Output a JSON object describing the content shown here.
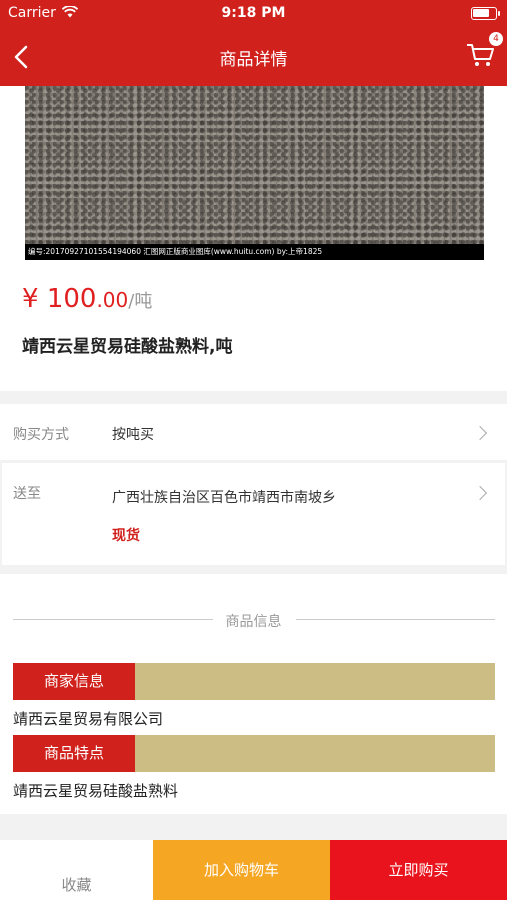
{
  "status_bar": {
    "carrier": "Carrier",
    "time": "9:18 PM"
  },
  "nav": {
    "title": "商品详情",
    "cart_badge": "4"
  },
  "image": {
    "watermark": "编号:20170927101554194060  汇图网正版商业图库(www.huitu.com)  by:上帝1825"
  },
  "product": {
    "price_symbol": "¥",
    "price_int": "100",
    "price_dec": ".00",
    "price_unit": "/吨",
    "name": "靖西云星贸易硅酸盐熟料,吨"
  },
  "purchase": {
    "label": "购买方式",
    "value": "按吨买"
  },
  "shipping": {
    "label": "送至",
    "address": "广西壮族自治区百色市靖西市南坡乡",
    "stock": "现货"
  },
  "info": {
    "title": "商品信息",
    "merchant_tag": "商家信息",
    "merchant_name": "靖西云星贸易有限公司",
    "feature_tag": "商品特点",
    "feature_text": "靖西云星贸易硅酸盐熟料"
  },
  "actions": {
    "favorite": "收藏",
    "add_to_cart": "加入购物车",
    "buy_now": "立即购买"
  },
  "colors": {
    "brand": "#d0211c",
    "cart_button": "#f5a623",
    "buy_button": "#e8131c",
    "tag_bar": "#cbbd83"
  }
}
